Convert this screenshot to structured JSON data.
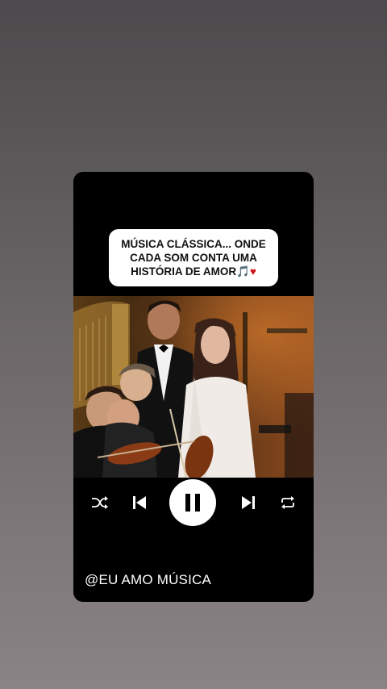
{
  "caption": {
    "line1": "MÚSICA CLÁSSICA... ONDE",
    "line2": "CADA SOM CONTA UMA",
    "line3": "HISTÓRIA DE AMOR",
    "emoji_music": "🎵",
    "emoji_heart": "♥"
  },
  "video": {
    "description_icons": [
      "concert-scene"
    ]
  },
  "player": {
    "state": "playing",
    "icons": {
      "shuffle": "shuffle-icon",
      "previous": "previous-icon",
      "pause": "pause-icon",
      "next": "next-icon",
      "repeat": "repeat-icon"
    }
  },
  "footer": {
    "handle": "@EU AMO MÚSICA"
  },
  "colors": {
    "card_bg": "#000000",
    "caption_bg": "#ffffff",
    "heart": "#d0121e"
  }
}
